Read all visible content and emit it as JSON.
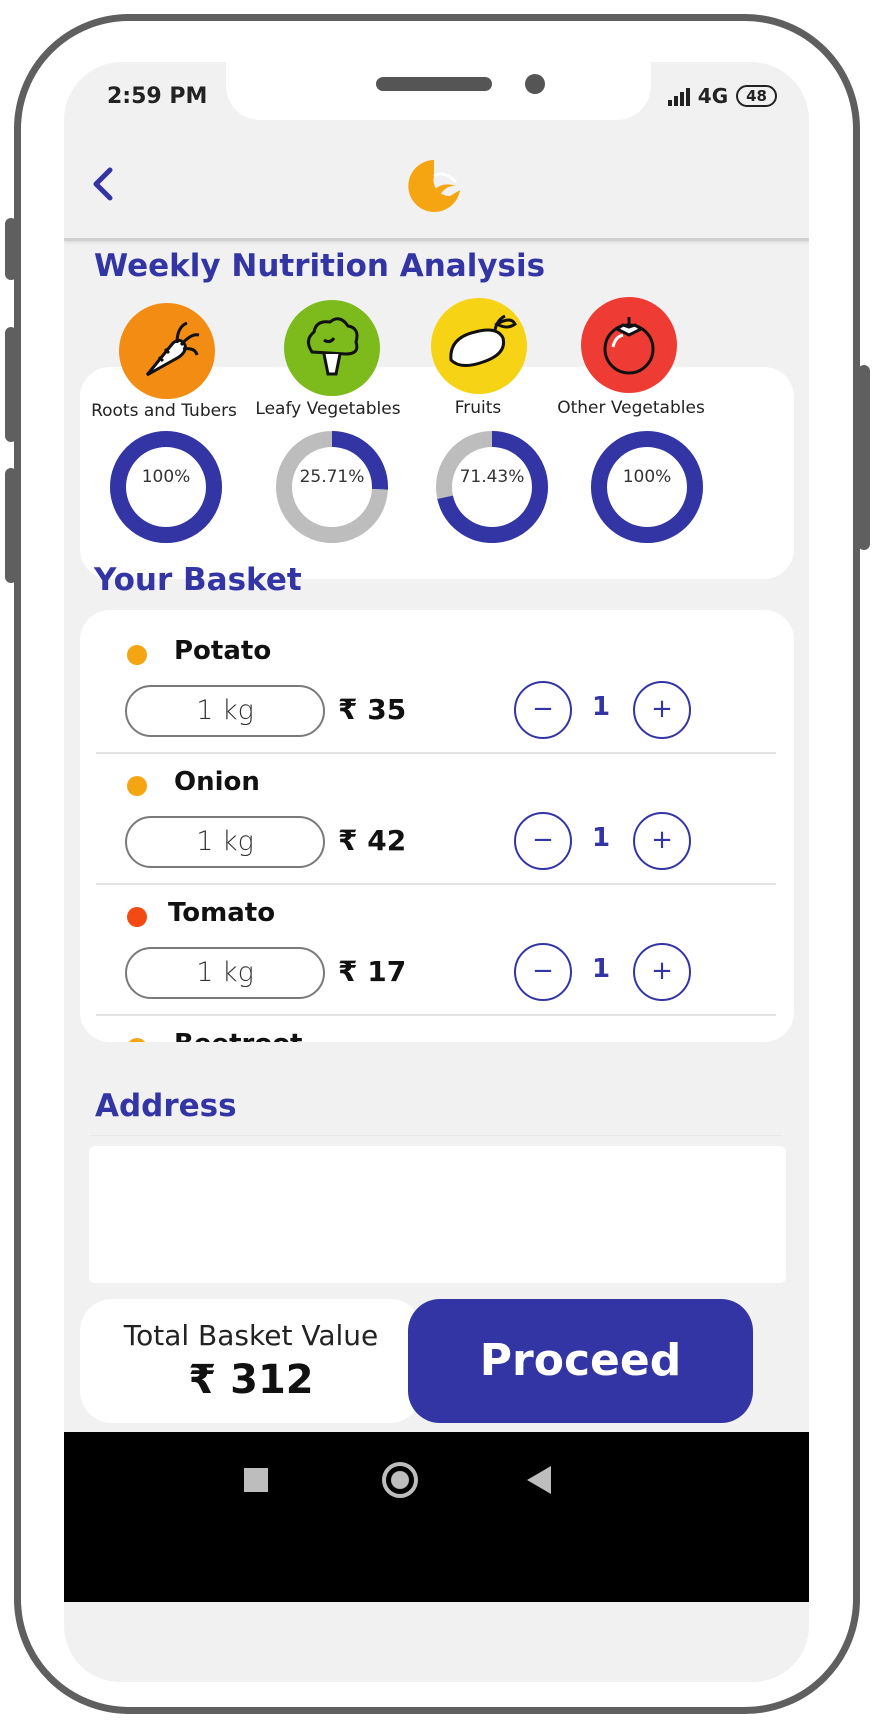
{
  "status_bar": {
    "time": "2:59 PM",
    "network": "4G",
    "battery": "48"
  },
  "header": {
    "back_icon": "chevron-left-icon",
    "logo_icon": "brand-logo-icon"
  },
  "nutrition": {
    "title": "Weekly Nutrition Analysis",
    "categories": [
      {
        "label": "Roots and Tubers",
        "icon": "carrot-icon",
        "icon_bg": "#f28c12",
        "percent_text": "100%",
        "value": 100
      },
      {
        "label": "Leafy Vegetables",
        "icon": "broccoli-icon",
        "icon_bg": "#7dbb1d",
        "percent_text": "25.71%",
        "value": 25.71
      },
      {
        "label": "Fruits",
        "icon": "mango-icon",
        "icon_bg": "#f7d316",
        "percent_text": "71.43%",
        "value": 71.43
      },
      {
        "label": "Other Vegetables",
        "icon": "tomato-icon",
        "icon_bg": "#ee3c35",
        "percent_text": "100%",
        "value": 100
      }
    ],
    "ring_color": "#3235a3",
    "track_color": "#bdbdbd"
  },
  "basket": {
    "title": "Your Basket",
    "items": [
      {
        "name": "Potato",
        "dot_color": "#f5a512",
        "unit": "1 kg",
        "price": "₹ 35",
        "count": "1"
      },
      {
        "name": "Onion",
        "dot_color": "#f5a512",
        "unit": "1 kg",
        "price": "₹ 42",
        "count": "1"
      },
      {
        "name": "Tomato",
        "dot_color": "#f24a12",
        "unit": "1 kg",
        "price": "₹ 17",
        "count": "1"
      },
      {
        "name": "Beetroot",
        "dot_color": "#f5a512",
        "unit": "",
        "price": "",
        "count": ""
      }
    ],
    "minus_label": "−",
    "plus_label": "+"
  },
  "address": {
    "title": "Address",
    "value": ""
  },
  "footer": {
    "total_label": "Total Basket Value",
    "total_value": "₹ 312",
    "proceed_label": "Proceed"
  },
  "colors": {
    "accent": "#3235a3",
    "background": "#f1f1f1"
  }
}
